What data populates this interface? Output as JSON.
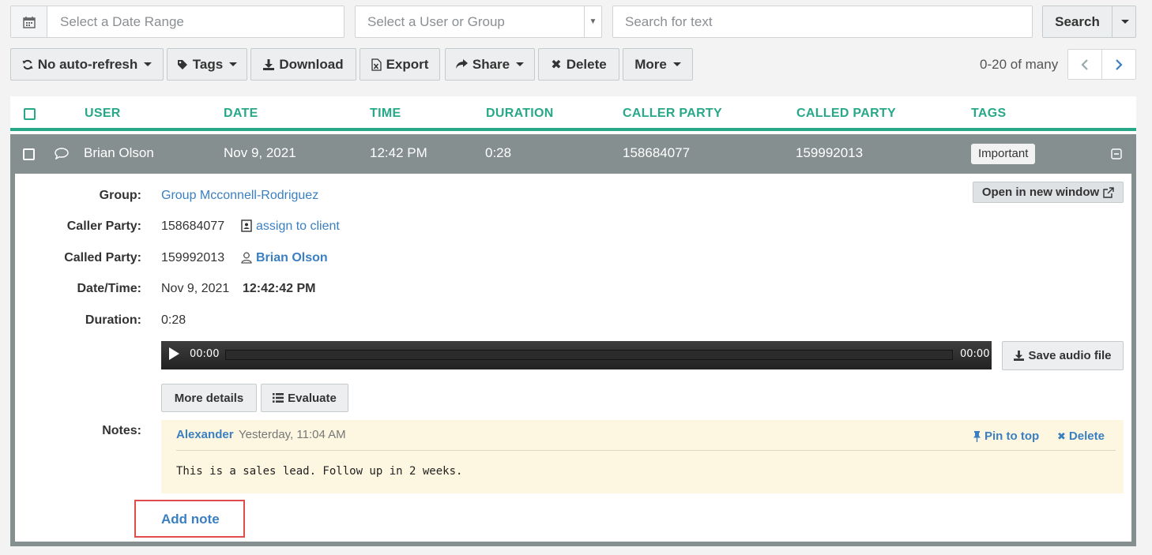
{
  "filters": {
    "date_range_placeholder": "Select a Date Range",
    "user_group_placeholder": "Select a User or Group",
    "search_text_placeholder": "Search for text",
    "search_label": "Search"
  },
  "toolbar": {
    "autorefresh_label": "No auto-refresh",
    "tags_label": "Tags",
    "download_label": "Download",
    "export_label": "Export",
    "share_label": "Share",
    "delete_label": "Delete",
    "more_label": "More",
    "pagination_text": "0-20 of many"
  },
  "table": {
    "columns": [
      "USER",
      "DATE",
      "TIME",
      "DURATION",
      "CALLER PARTY",
      "CALLED PARTY",
      "TAGS"
    ],
    "row": {
      "user": "Brian Olson",
      "date": "Nov 9, 2021",
      "time": "12:42 PM",
      "duration": "0:28",
      "caller_party": "158684077",
      "called_party": "159992013",
      "tag": "Important"
    }
  },
  "detail": {
    "open_new_window_label": "Open in new window",
    "group_label": "Group:",
    "group_value": "Group Mcconnell-Rodriguez",
    "caller_label": "Caller Party:",
    "caller_value": "158684077",
    "assign_client_label": "assign to client",
    "called_label": "Called Party:",
    "called_value": "159992013",
    "called_user": "Brian Olson",
    "datetime_label": "Date/Time:",
    "date_value": "Nov 9, 2021",
    "time_value": "12:42:42 PM",
    "duration_label": "Duration:",
    "duration_value": "0:28",
    "audio_current": "00:00",
    "audio_total": "00:00",
    "save_audio_label": "Save audio file",
    "more_details_label": "More details",
    "evaluate_label": "Evaluate",
    "notes_label": "Notes:",
    "note": {
      "author": "Alexander",
      "timestamp": "Yesterday, 11:04 AM",
      "pin_label": "Pin to top",
      "delete_label": "Delete",
      "text": "This is a sales lead. Follow up in 2 weeks."
    },
    "add_note_label": "Add note"
  },
  "colors": {
    "accent": "#27a889",
    "row_header": "#858f8f",
    "link": "#3a7fc1",
    "note_bg": "#fdf6e0",
    "highlight": "#e04b4b"
  }
}
